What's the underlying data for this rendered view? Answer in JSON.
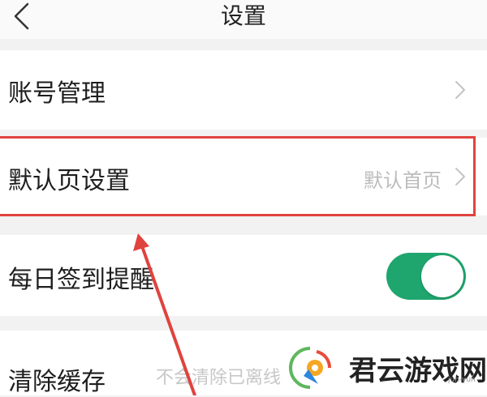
{
  "header": {
    "title": "设置",
    "back_icon": "chevron-left-icon"
  },
  "settings": {
    "account": {
      "label": "账号管理"
    },
    "default_page": {
      "label": "默认页设置",
      "value": "默认首页"
    },
    "daily_signin": {
      "label": "每日签到提醒",
      "toggle_on": true
    },
    "clear_cache": {
      "label": "清除缓存",
      "description": "不会清除已离线"
    }
  },
  "annotation": {
    "color": "#e0433e"
  },
  "watermark": {
    "text": "君云游戏网",
    "url": "jun-yun"
  },
  "colors": {
    "accent": "#1fa56e"
  }
}
